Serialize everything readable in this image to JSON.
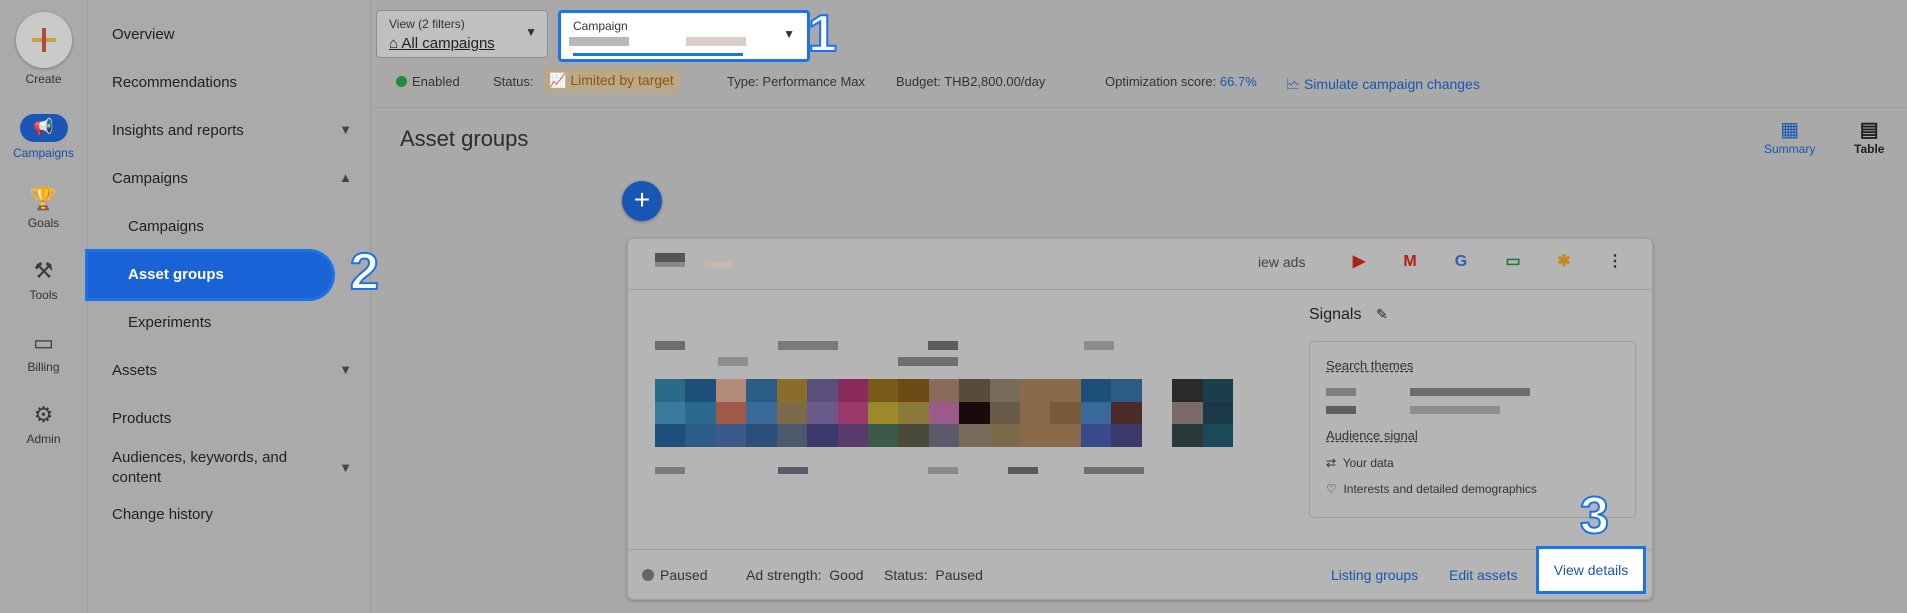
{
  "rail": {
    "create": "Create",
    "campaigns": "Campaigns",
    "goals": "Goals",
    "tools": "Tools",
    "billing": "Billing",
    "admin": "Admin"
  },
  "nav": {
    "overview": "Overview",
    "recommendations": "Recommendations",
    "insights": "Insights and reports",
    "campaigns": "Campaigns",
    "campaigns_sub": "Campaigns",
    "asset_groups": "Asset groups",
    "experiments": "Experiments",
    "assets": "Assets",
    "products": "Products",
    "audiences": "Audiences, keywords, and content",
    "change_history": "Change history"
  },
  "filters": {
    "view_label": "View (2 filters)",
    "view_value": "All campaigns",
    "campaign_label": "Campaign"
  },
  "status_bar": {
    "enabled": "Enabled",
    "status_label": "Status:",
    "status_value": "Limited by target",
    "type": "Type: Performance Max",
    "budget": "Budget: THB2,800.00/day",
    "opt_label": "Optimization score:",
    "opt_value": "66.7%",
    "simulate": "Simulate campaign changes"
  },
  "page": {
    "title": "Asset groups",
    "summary": "Summary",
    "table": "Table"
  },
  "card": {
    "view_ads": "iew ads",
    "signals": "Signals",
    "search_themes": "Search themes",
    "audience_signal": "Audience signal",
    "your_data": "Your data",
    "interests": "Interests and detailed demographics",
    "paused": "Paused",
    "ad_strength_label": "Ad strength:",
    "ad_strength_value": "Good",
    "status_label": "Status:",
    "status_value": "Paused",
    "listing_groups": "Listing groups",
    "edit_assets": "Edit assets",
    "view_details": "View details"
  },
  "callouts": {
    "one": "1",
    "two": "2",
    "three": "3"
  }
}
